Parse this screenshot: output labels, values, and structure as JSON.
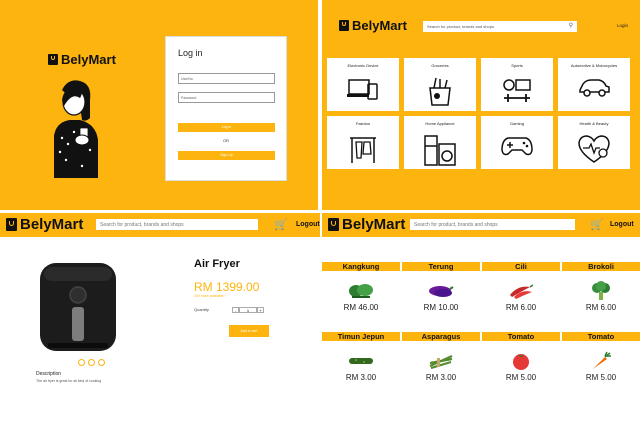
{
  "brand": {
    "name": "BelyMart"
  },
  "login_page": {
    "title": "Log in",
    "username_placeholder": "UserNo",
    "password_placeholder": "Password",
    "login_button": "Log in",
    "or_text": "OR",
    "signup_button": "Sign Up"
  },
  "category_page": {
    "search_placeholder": "Search for product, brands and shops",
    "login_link": "Login",
    "categories": [
      {
        "label": "Electronic Device",
        "icon": "devices-icon"
      },
      {
        "label": "Groceries",
        "icon": "grocery-bag-icon"
      },
      {
        "label": "Sports",
        "icon": "sports-icon"
      },
      {
        "label": "Automotive & Motorcycles",
        "icon": "car-icon"
      },
      {
        "label": "Fashion",
        "icon": "clothes-rack-icon"
      },
      {
        "label": "Home Appliance",
        "icon": "appliance-icon"
      },
      {
        "label": "Gaming",
        "icon": "gamepad-icon"
      },
      {
        "label": "Health & Beauty",
        "icon": "heart-health-icon"
      }
    ]
  },
  "product_page": {
    "search_placeholder": "Search for product, brands and shops",
    "logout": "Logout",
    "product_title": "Air Fryer",
    "price": "RM 1399.00",
    "stock_text": "200 more available !",
    "quantity_label": "Quantity",
    "quantity_value": "1",
    "minus": "-",
    "plus": "+",
    "add_to_cart": "Add to cart",
    "description_heading": "Description",
    "description_text": "The air fryer is great for all kind of cooking"
  },
  "grocery_page": {
    "search_placeholder": "Search for product, brands and shops",
    "logout": "Logout",
    "items": [
      {
        "name": "Kangkung",
        "price": "RM 46.00",
        "icon": "leafy-greens-icon",
        "color": "#2e7d32"
      },
      {
        "name": "Terung",
        "price": "RM 10.00",
        "icon": "eggplant-icon",
        "color": "#6a1b9a"
      },
      {
        "name": "Cili",
        "price": "RM 6.00",
        "icon": "chili-icon",
        "color": "#c62828"
      },
      {
        "name": "Brokoli",
        "price": "RM 6.00",
        "icon": "broccoli-icon",
        "color": "#388e3c"
      },
      {
        "name": "Timun Jepun",
        "price": "RM 3.00",
        "icon": "cucumber-icon",
        "color": "#33691e"
      },
      {
        "name": "Asparagus",
        "price": "RM 3.00",
        "icon": "asparagus-icon",
        "color": "#558b2f"
      },
      {
        "name": "Tomato",
        "price": "RM 5.00",
        "icon": "tomato-icon",
        "color": "#e53935"
      },
      {
        "name": "Tomato",
        "price": "RM 5.00",
        "icon": "carrot-icon",
        "color": "#ef6c00"
      }
    ]
  },
  "colors": {
    "accent": "#fdb40e"
  }
}
